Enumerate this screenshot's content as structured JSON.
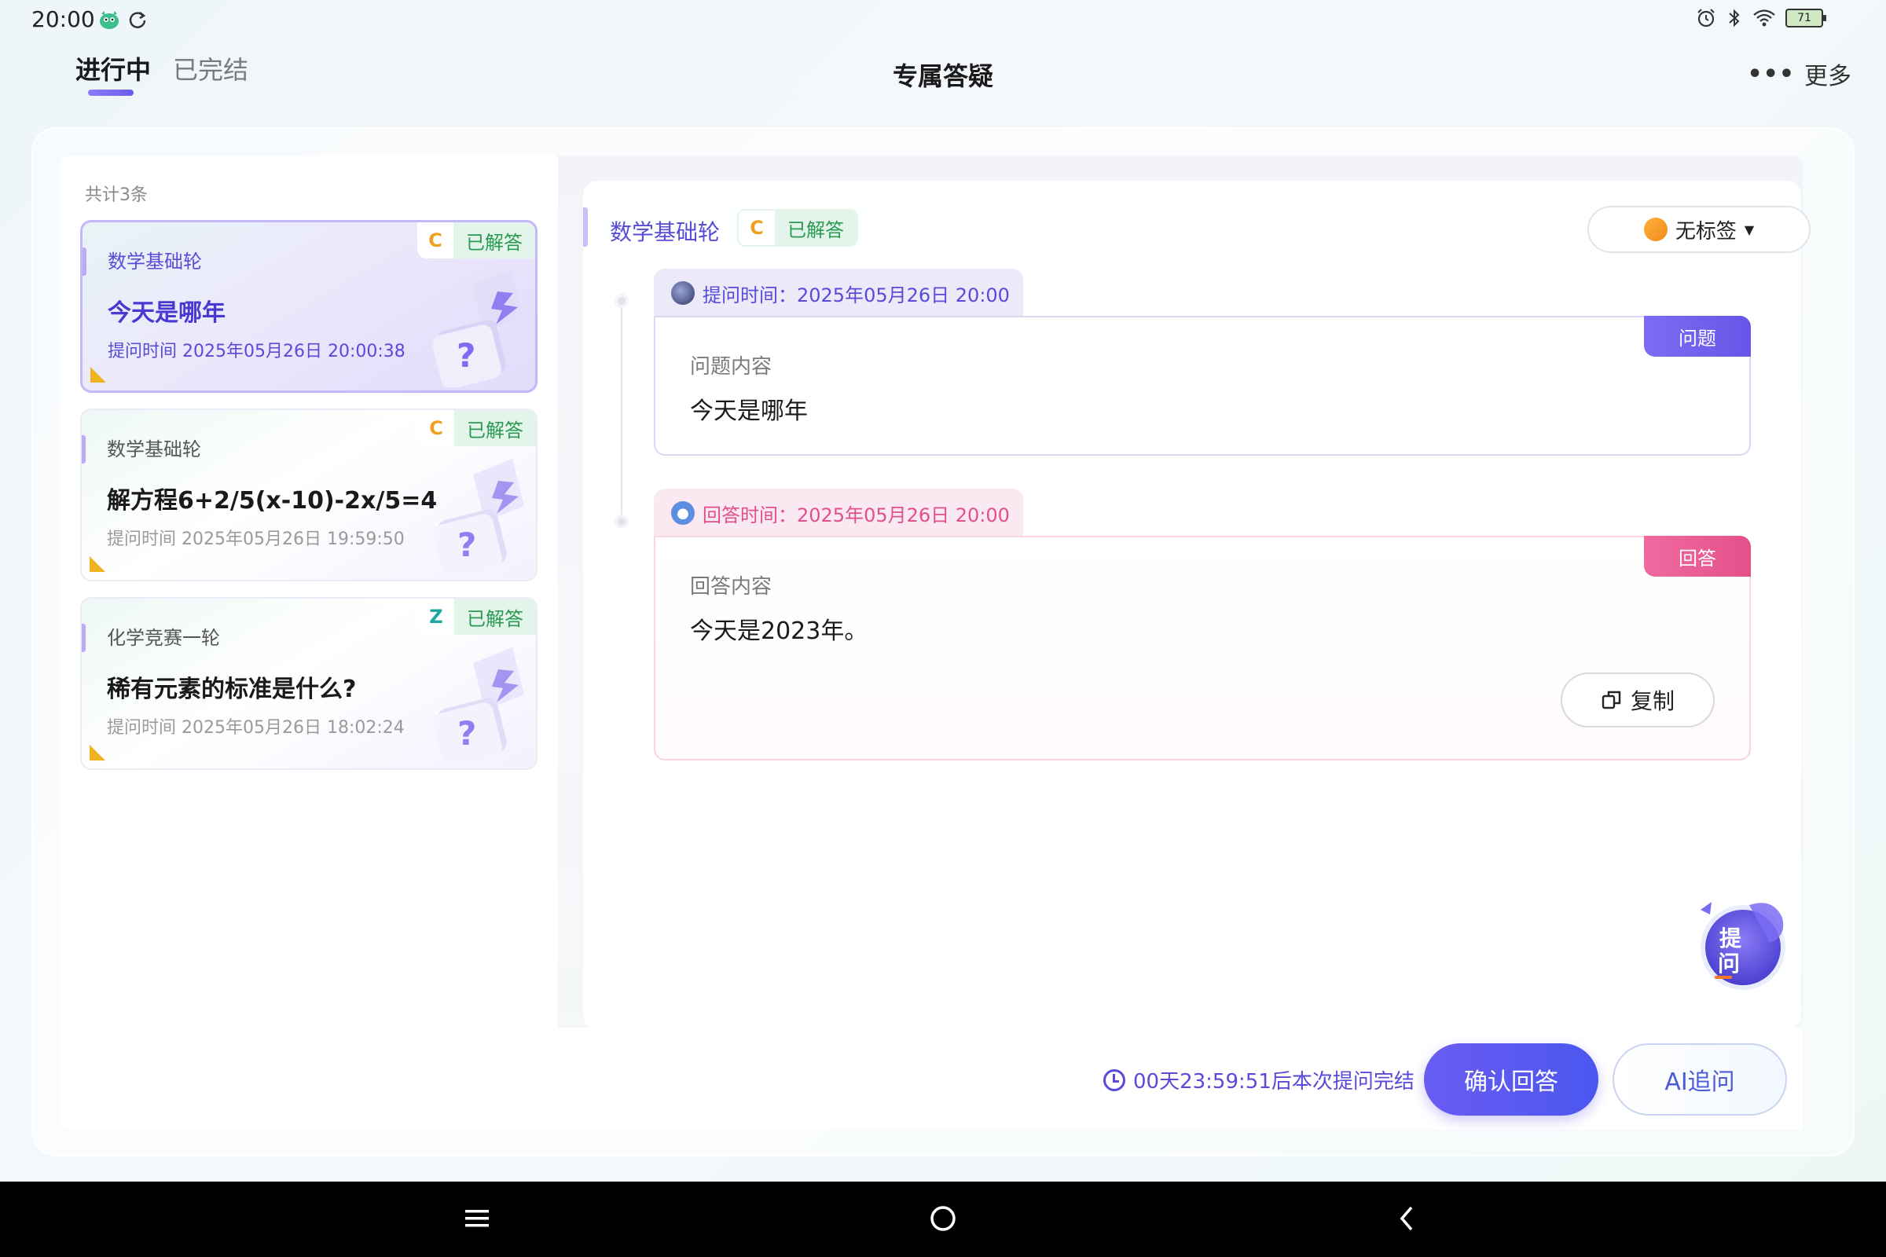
{
  "status_bar": {
    "time": "20:00",
    "battery": "71",
    "icons": [
      "app-icon",
      "sync-icon",
      "alarm-icon",
      "bluetooth-icon",
      "wifi-icon",
      "battery-icon"
    ]
  },
  "header": {
    "tabs": [
      {
        "label": "进行中",
        "active": true
      },
      {
        "label": "已完结",
        "active": false
      }
    ],
    "title": "专属答疑",
    "more_label": "更多"
  },
  "list": {
    "count_label": "共计3条",
    "items": [
      {
        "subject": "数学基础轮",
        "title": "今天是哪年",
        "time": "提问时间 2025年05月26日 20:00:38",
        "badge_letter": "C",
        "status": "已解答",
        "active": true
      },
      {
        "subject": "数学基础轮",
        "title": "解方程6+2/5(x-10)-2x/5=4",
        "time": "提问时间 2025年05月26日 19:59:50",
        "badge_letter": "C",
        "status": "已解答",
        "active": false
      },
      {
        "subject": "化学竞赛一轮",
        "title": "稀有元素的标准是什么?",
        "time": "提问时间 2025年05月26日 18:02:24",
        "badge_letter": "Z",
        "status": "已解答",
        "active": false
      }
    ]
  },
  "detail": {
    "subject": "数学基础轮",
    "badge_letter": "C",
    "status": "已解答",
    "tag_button": "无标签",
    "question": {
      "time": "提问时间：2025年05月26日 20:00",
      "corner_tag": "问题",
      "label": "问题内容",
      "content": "今天是哪年"
    },
    "answer": {
      "time": "回答时间：2025年05月26日 20:00",
      "corner_tag": "回答",
      "label": "回答内容",
      "content": "今天是2023年。",
      "copy_label": "复制"
    },
    "fab_label": "提问"
  },
  "footer": {
    "countdown": "00天23:59:51后本次提问完结",
    "confirm_label": "确认回答",
    "ai_label": "AI追问"
  },
  "colors": {
    "accent": "#6a5cf2",
    "answered_green": "#2a9a52",
    "answer_pink": "#e4508a",
    "badge_c": "#f0a020",
    "badge_z": "#1aa8a0"
  }
}
